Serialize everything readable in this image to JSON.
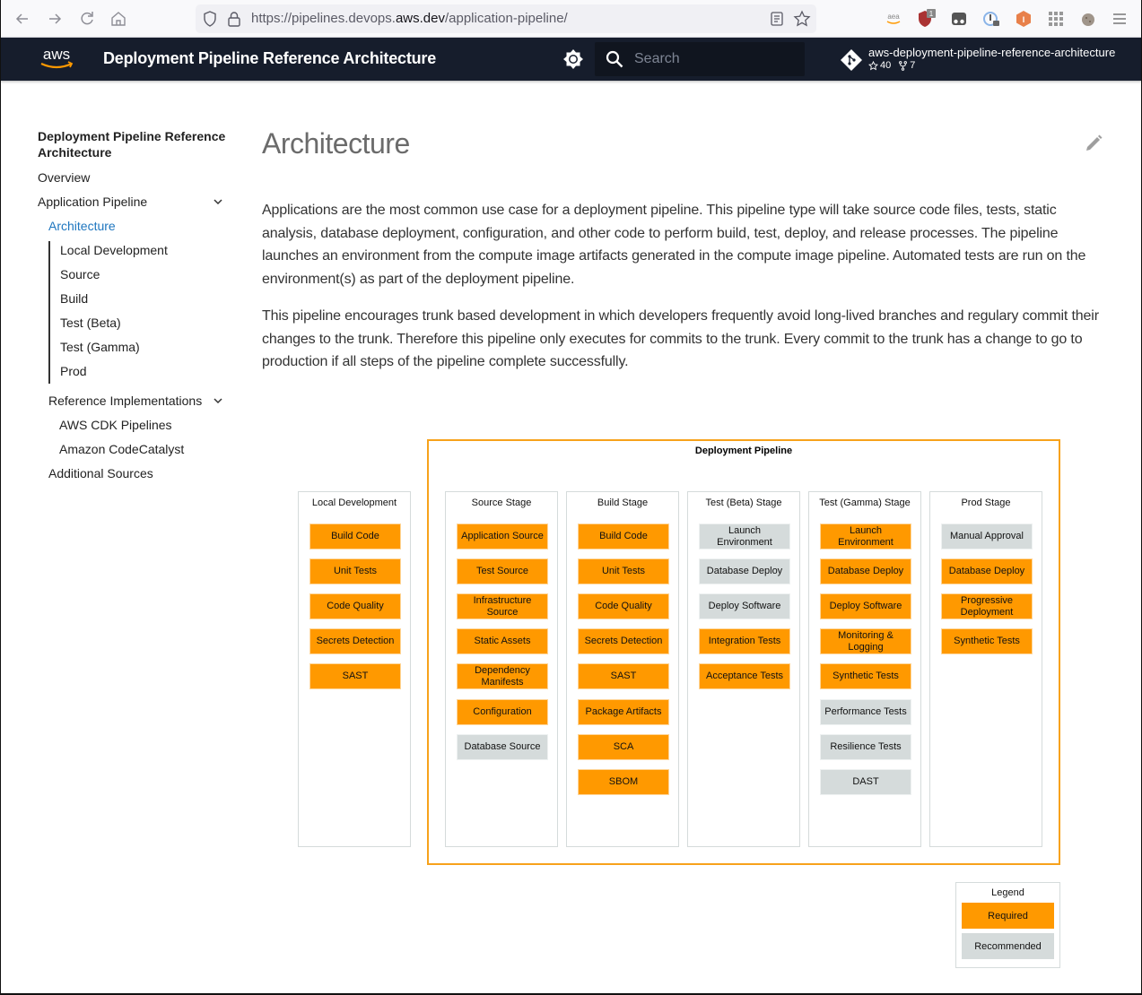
{
  "browser": {
    "url_prefix": "https://pipelines.devops.",
    "url_host": "aws.dev",
    "url_path": "/application-pipeline/",
    "nav": [
      "back-icon",
      "forward-icon",
      "reload-icon",
      "home-icon"
    ],
    "extensions": [
      {
        "name": "amazon-assistant-icon",
        "badge": ""
      },
      {
        "name": "ublock-icon",
        "badge": "1"
      },
      {
        "name": "glasses-icon",
        "badge": ""
      },
      {
        "name": "password-manager-icon",
        "badge": ""
      },
      {
        "name": "hexagon-extension-icon",
        "badge": ""
      },
      {
        "name": "apps-grid-icon",
        "badge": ""
      },
      {
        "name": "cookie-icon",
        "badge": ""
      },
      {
        "name": "menu-icon",
        "badge": ""
      }
    ]
  },
  "header": {
    "logo_text": "aws",
    "title": "Deployment Pipeline Reference Architecture",
    "search_placeholder": "Search",
    "repo_name": "aws-deployment-pipeline-reference-architecture",
    "stars": "40",
    "forks": "7"
  },
  "sidebar": {
    "title": "Deployment Pipeline Reference Architecture",
    "overview": "Overview",
    "application_pipeline": "Application Pipeline",
    "architecture": "Architecture",
    "sub_items": [
      "Local Development",
      "Source",
      "Build",
      "Test (Beta)",
      "Test (Gamma)",
      "Prod"
    ],
    "reference_implementations": "Reference Implementations",
    "ref_items": [
      "AWS CDK Pipelines",
      "Amazon CodeCatalyst"
    ],
    "additional_sources": "Additional Sources"
  },
  "content": {
    "title": "Architecture",
    "paragraphs": [
      "Applications are the most common use case for a deployment pipeline. This pipeline type will take source code files, tests, static analysis, database deployment, configuration, and other code to perform build, test, deploy, and release processes. The pipeline launches an environment from the compute image artifacts generated in the compute image pipeline. Automated tests are run on the environment(s) as part of the deployment pipeline.",
      "This pipeline encourages trunk based development in which developers frequently avoid long-lived branches and regulary commit their changes to the trunk. Therefore this pipeline only executes for commits to the trunk. Every commit to the trunk has a change to go to production if all steps of the pipeline complete successfully."
    ]
  },
  "diagram": {
    "pipeline_title": "Deployment Pipeline",
    "colors": {
      "required": "#ff9900",
      "recommended": "#d5dbdb",
      "frame": "#f7a21b"
    },
    "stages": [
      {
        "title": "Local Development",
        "steps": [
          {
            "label": "Build Code",
            "type": "required"
          },
          {
            "label": "Unit Tests",
            "type": "required"
          },
          {
            "label": "Code Quality",
            "type": "required"
          },
          {
            "label": "Secrets Detection",
            "type": "required"
          },
          {
            "label": "SAST",
            "type": "required"
          }
        ]
      },
      {
        "title": "Source Stage",
        "steps": [
          {
            "label": "Application Source",
            "type": "required"
          },
          {
            "label": "Test Source",
            "type": "required"
          },
          {
            "label": "Infrastructure Source",
            "type": "required"
          },
          {
            "label": "Static Assets",
            "type": "required"
          },
          {
            "label": "Dependency Manifests",
            "type": "required"
          },
          {
            "label": "Configuration",
            "type": "required"
          },
          {
            "label": "Database Source",
            "type": "recommended"
          }
        ]
      },
      {
        "title": "Build Stage",
        "steps": [
          {
            "label": "Build Code",
            "type": "required"
          },
          {
            "label": "Unit Tests",
            "type": "required"
          },
          {
            "label": "Code Quality",
            "type": "required"
          },
          {
            "label": "Secrets Detection",
            "type": "required"
          },
          {
            "label": "SAST",
            "type": "required"
          },
          {
            "label": "Package Artifacts",
            "type": "required"
          },
          {
            "label": "SCA",
            "type": "required"
          },
          {
            "label": "SBOM",
            "type": "required"
          }
        ]
      },
      {
        "title": "Test (Beta) Stage",
        "steps": [
          {
            "label": "Launch Environment",
            "type": "recommended"
          },
          {
            "label": "Database Deploy",
            "type": "recommended"
          },
          {
            "label": "Deploy Software",
            "type": "recommended"
          },
          {
            "label": "Integration Tests",
            "type": "required"
          },
          {
            "label": "Acceptance Tests",
            "type": "required"
          }
        ]
      },
      {
        "title": "Test (Gamma) Stage",
        "steps": [
          {
            "label": "Launch Environment",
            "type": "required"
          },
          {
            "label": "Database Deploy",
            "type": "required"
          },
          {
            "label": "Deploy Software",
            "type": "required"
          },
          {
            "label": "Monitoring & Logging",
            "type": "required"
          },
          {
            "label": "Synthetic Tests",
            "type": "required"
          },
          {
            "label": "Performance Tests",
            "type": "recommended"
          },
          {
            "label": "Resilience Tests",
            "type": "recommended"
          },
          {
            "label": "DAST",
            "type": "recommended"
          }
        ]
      },
      {
        "title": "Prod Stage",
        "steps": [
          {
            "label": "Manual Approval",
            "type": "recommended"
          },
          {
            "label": "Database Deploy",
            "type": "required"
          },
          {
            "label": "Progressive Deployment",
            "type": "required"
          },
          {
            "label": "Synthetic Tests",
            "type": "required"
          }
        ]
      }
    ],
    "legend": {
      "title": "Legend",
      "required": "Required",
      "recommended": "Recommended"
    }
  }
}
